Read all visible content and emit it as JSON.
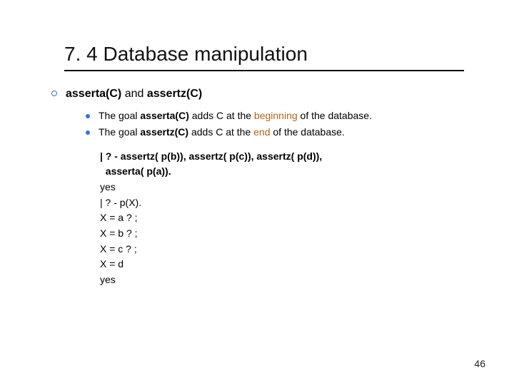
{
  "title": "7. 4 Database manipulation",
  "section": {
    "prefix": "asserta(C)",
    "mid": " and ",
    "suffix": "assertz(C)"
  },
  "bullets": [
    {
      "pre": "The goal ",
      "strong": "asserta(C)",
      "mid": " adds C at the ",
      "hl": "beginning",
      "post": " of the database."
    },
    {
      "pre": "The goal ",
      "strong": "assertz(C)",
      "mid": " adds C at the ",
      "hl": "end",
      "post": " of the database."
    }
  ],
  "code": {
    "line1a": "| ? - assertz( p(b)), assertz( p(c)), assertz( p(d)),",
    "line1b": "  asserta( p(a)).",
    "rest": "yes\n| ? - p(X).\nX = a ? ;\nX = b ? ;\nX = c ? ;\nX = d\nyes"
  },
  "page": "46"
}
